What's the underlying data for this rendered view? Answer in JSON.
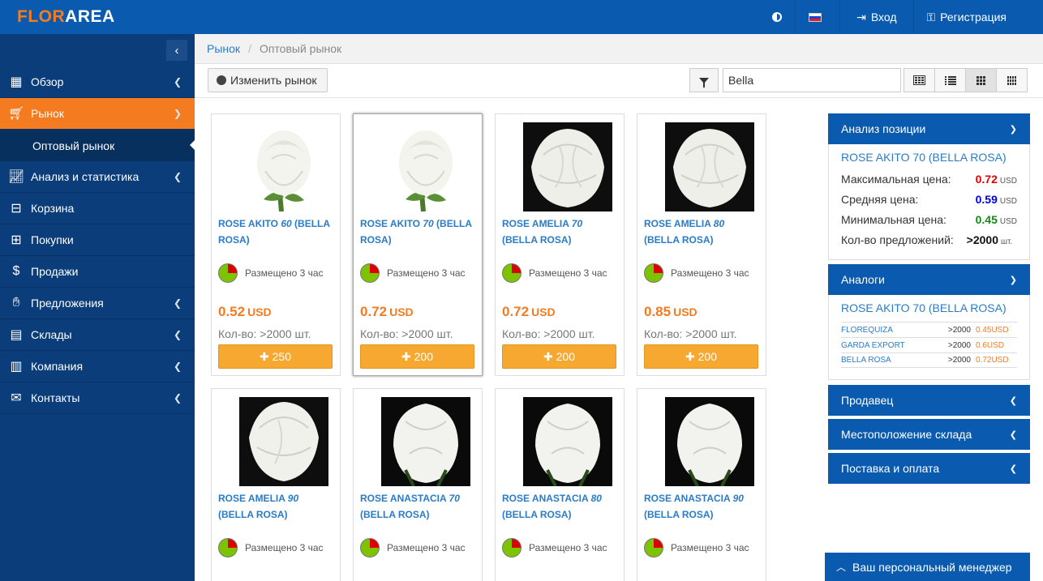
{
  "brand": {
    "logo_part1": "FLOR",
    "logo_part2": "AREA"
  },
  "topbar": {
    "login": "Вход",
    "register": "Регистрация"
  },
  "sidebar": {
    "items": [
      {
        "label": "Обзор",
        "icon": "presentation-icon"
      },
      {
        "label": "Рынок",
        "icon": "cart-icon",
        "active": true
      },
      {
        "label": "Оптовый рынок",
        "sub": true
      },
      {
        "label": "Анализ и статистика",
        "icon": "chart-icon"
      },
      {
        "label": "Корзина",
        "icon": "basket-icon"
      },
      {
        "label": "Покупки",
        "icon": "purchases-icon"
      },
      {
        "label": "Продажи",
        "icon": "sales-icon"
      },
      {
        "label": "Предложения",
        "icon": "offers-icon"
      },
      {
        "label": "Склады",
        "icon": "warehouse-icon"
      },
      {
        "label": "Компания",
        "icon": "building-icon"
      },
      {
        "label": "Контакты",
        "icon": "envelope-icon"
      }
    ]
  },
  "breadcrumb": {
    "root": "Рынок",
    "current": "Оптовый рынок"
  },
  "toolbar": {
    "change_market": "Изменить рынок",
    "search_value": "Bella"
  },
  "products": [
    {
      "name_pre": "ROSE AKITO ",
      "length": "60",
      "name_post": " (BELLA ROSA)",
      "posted": "Размещено 3 час",
      "price": "0.52",
      "currency": "USD",
      "qty": "Кол-во: >2000 шт.",
      "btn": "250"
    },
    {
      "name_pre": "ROSE AKITO ",
      "length": "70",
      "name_post": " (BELLA ROSA)",
      "posted": "Размещено 3 час",
      "price": "0.72",
      "currency": "USD",
      "qty": "Кол-во: >2000 шт.",
      "btn": "200"
    },
    {
      "name_pre": "ROSE AMELIA ",
      "length": "70",
      "name_post": " (BELLA ROSA)",
      "posted": "Размещено 3 час",
      "price": "0.72",
      "currency": "USD",
      "qty": "Кол-во: >2000 шт.",
      "btn": "200"
    },
    {
      "name_pre": "ROSE AMELIA ",
      "length": "80",
      "name_post": " (BELLA ROSA)",
      "posted": "Размещено 3 час",
      "price": "0.85",
      "currency": "USD",
      "qty": "Кол-во: >2000 шт.",
      "btn": "200"
    },
    {
      "name_pre": "ROSE AMELIA ",
      "length": "90",
      "name_post": " (BELLA ROSA)",
      "posted": "Размещено 3 час"
    },
    {
      "name_pre": "ROSE ANASTACIA ",
      "length": "70",
      "name_post": " (BELLA ROSA)",
      "posted": "Размещено 3 час"
    },
    {
      "name_pre": "ROSE ANASTACIA ",
      "length": "80",
      "name_post": " (BELLA ROSA)",
      "posted": "Размещено 3 час"
    },
    {
      "name_pre": "ROSE ANASTACIA ",
      "length": "90",
      "name_post": " (BELLA ROSA)",
      "posted": "Размещено 3 час"
    }
  ],
  "analysis": {
    "header": "Анализ позиции",
    "title": "ROSE AKITO 70 (BELLA ROSA)",
    "max_label": "Максимальная цена:",
    "max_value": "0.72",
    "max_unit": "USD",
    "avg_label": "Средняя цена:",
    "avg_value": "0.59",
    "avg_unit": "USD",
    "min_label": "Минимальная цена:",
    "min_value": "0.45",
    "min_unit": "USD",
    "count_label": "Кол-во предложений:",
    "count_value": ">2000",
    "count_unit": "шт."
  },
  "analogs": {
    "header": "Аналоги",
    "title": "ROSE AKITO 70 (BELLA ROSA)",
    "rows": [
      {
        "name": "FLOREQUIZA",
        "qty": ">2000",
        "price": "0.45USD"
      },
      {
        "name": "GARDA EXPORT",
        "qty": ">2000",
        "price": "0.6USD"
      },
      {
        "name": "BELLA ROSA",
        "qty": ">2000",
        "price": "0.72USD"
      }
    ]
  },
  "panels": {
    "seller": "Продавец",
    "warehouse": "Местоположение склада",
    "delivery": "Поставка и оплата"
  },
  "manager": {
    "label": "Ваш персональный менеджер"
  },
  "colors": {
    "brand_blue": "#0a5bb0",
    "sidebar": "#0b3d7a",
    "accent_orange": "#f47b20",
    "button_orange": "#f7a831",
    "link_blue": "#2a7cc7"
  }
}
